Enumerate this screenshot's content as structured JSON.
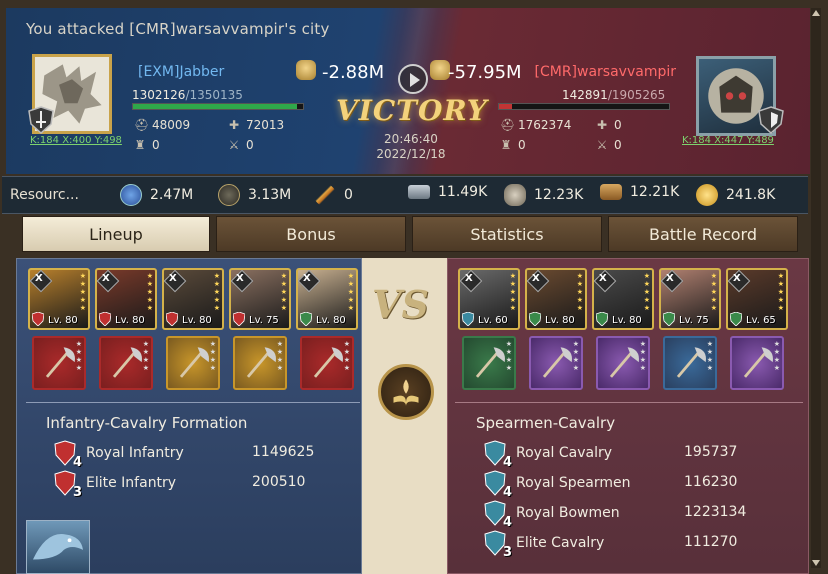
{
  "headline": "You attacked [CMR]warsavvampir's city",
  "attacker": {
    "name": "[EXM]Jabber",
    "coords": "K:184 X:400 Y:498",
    "hp_current": "1302126",
    "hp_max": "/1350135",
    "hp_fraction": 0.964,
    "troops": "48009",
    "wounded": "72013",
    "stat3": "0",
    "stat4": "0",
    "power_change": "-2.88M"
  },
  "defender": {
    "name": "[CMR]warsavvampir",
    "coords": "K:184 X:447 Y:489",
    "hp_current": "142891",
    "hp_max": "/1905265",
    "hp_fraction": 0.075,
    "troops": "1762374",
    "wounded": "0",
    "stat3": "0",
    "stat4": "0",
    "power_change": "-57.95M"
  },
  "result": "VICTORY",
  "time": "20:46:40",
  "date": "2022/12/18",
  "resources": {
    "title": "Resourc...",
    "items": [
      {
        "icon": "exp-icon",
        "value": "2.47M"
      },
      {
        "icon": "laurel-icon",
        "value": "3.13M"
      },
      {
        "icon": "feather-icon",
        "value": "0"
      },
      {
        "icon": "iron-icon",
        "value": "11.49K"
      },
      {
        "icon": "stone-icon",
        "value": "12.23K"
      },
      {
        "icon": "wood-icon",
        "value": "12.21K"
      },
      {
        "icon": "gold-icon",
        "value": "241.8K"
      }
    ]
  },
  "tabs": [
    "Lineup",
    "Bonus",
    "Statistics",
    "Battle Record"
  ],
  "active_tab": "Lineup",
  "left_heroes": [
    {
      "level": "Lv. 80",
      "stars": 5,
      "badge": "shield-skull",
      "color": "#b8802c"
    },
    {
      "level": "Lv. 80",
      "stars": 5,
      "badge": "shield",
      "color": "#7a3a2a"
    },
    {
      "level": "Lv. 80",
      "stars": 5,
      "badge": "shield",
      "color": "#5a4a3a"
    },
    {
      "level": "Lv. 75",
      "stars": 5,
      "badge": "shield",
      "color": "#8a7060"
    },
    {
      "level": "Lv. 80",
      "stars": 5,
      "badge": "spear",
      "color": "#c8b090"
    }
  ],
  "right_heroes": [
    {
      "level": "Lv. 60",
      "stars": 5,
      "badge": "horse",
      "color": "#6a6a6a"
    },
    {
      "level": "Lv. 80",
      "stars": 5,
      "badge": "spear",
      "color": "#6a4a30"
    },
    {
      "level": "Lv. 80",
      "stars": 5,
      "badge": "spear",
      "color": "#4a4a4a"
    },
    {
      "level": "Lv. 75",
      "stars": 5,
      "badge": "spear",
      "color": "#b08070"
    },
    {
      "level": "Lv. 65",
      "stars": 5,
      "badge": "spear",
      "color": "#5a3a2a"
    }
  ],
  "left_gear": [
    {
      "border": "#aa2a2a",
      "bg": "#7a1f1f"
    },
    {
      "border": "#aa2a2a",
      "bg": "#7a1f1f"
    },
    {
      "border": "#c8962a",
      "bg": "#7a5a20"
    },
    {
      "border": "#c8962a",
      "bg": "#7a5a20"
    },
    {
      "border": "#aa2a2a",
      "bg": "#7a1f1f"
    }
  ],
  "right_gear": [
    {
      "border": "#3a7a4a",
      "bg": "#244a30"
    },
    {
      "border": "#8a5ab0",
      "bg": "#4a2a6a"
    },
    {
      "border": "#8a5ab0",
      "bg": "#4a2a6a"
    },
    {
      "border": "#3a6a9a",
      "bg": "#2a4060"
    },
    {
      "border": "#8a5ab0",
      "bg": "#4a2a6a"
    }
  ],
  "left_formation": {
    "title": "Infantry-Cavalry Formation",
    "rows": [
      {
        "tier": "4",
        "name": "Royal Infantry",
        "count": "1149625"
      },
      {
        "tier": "3",
        "name": "Elite Infantry",
        "count": "200510"
      }
    ]
  },
  "right_formation": {
    "title": "Spearmen-Cavalry",
    "rows": [
      {
        "tier": "4",
        "name": "Royal Cavalry",
        "count": "195737"
      },
      {
        "tier": "4",
        "name": "Royal Spearmen",
        "count": "116230"
      },
      {
        "tier": "4",
        "name": "Royal Bowmen",
        "count": "1223134"
      },
      {
        "tier": "3",
        "name": "Elite Cavalry",
        "count": "111270"
      }
    ]
  },
  "vs_label": "VS",
  "colors": {
    "attacker_hp": "#2fa84a",
    "defender_hp": "#c23434",
    "attacker_name": "#72b8f0",
    "defender_name": "#ff6a6a",
    "coord": "#7dd36e",
    "victory": "#f3d27c"
  }
}
